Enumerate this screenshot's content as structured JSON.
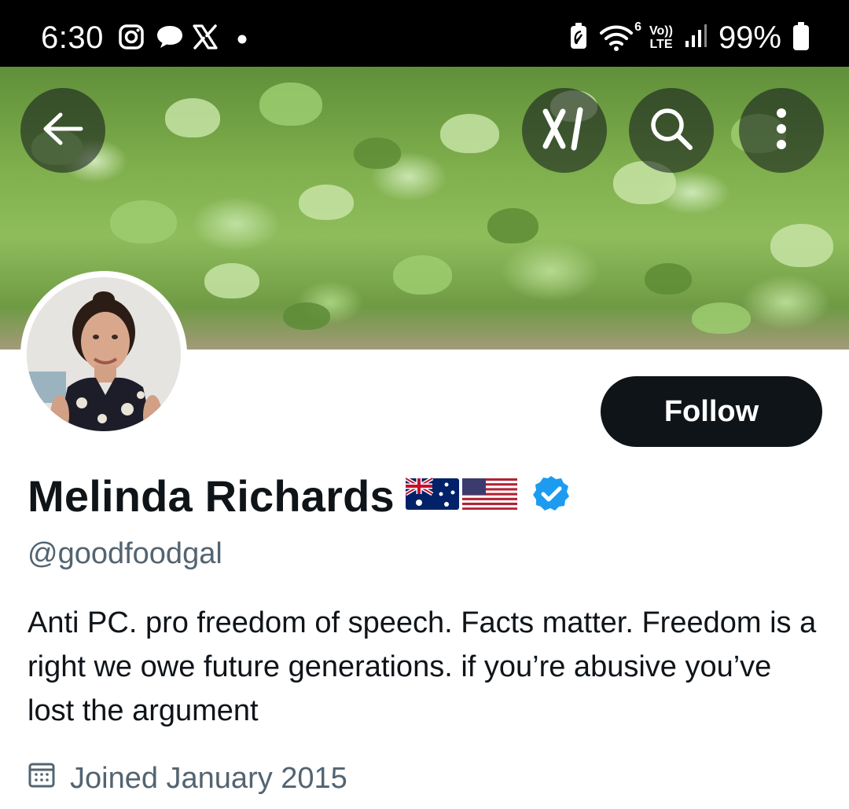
{
  "status_bar": {
    "time": "6:30",
    "battery": "99%",
    "left_icons": [
      "instagram-icon",
      "chat-bubble-icon",
      "x-logo-icon",
      "dot-icon"
    ],
    "right_icons": [
      "battery-saver-icon",
      "wifi-6-icon",
      "volte-lte-icon",
      "signal-icon",
      "battery-icon"
    ],
    "net_top": "Vo))",
    "net_bottom": "LTE",
    "wifi_badge": "6"
  },
  "header": {
    "back_icon": "arrow-left-icon",
    "grok_icon": "grok-icon",
    "search_icon": "search-icon",
    "more_icon": "more-vertical-icon"
  },
  "profile": {
    "display_name": "Melinda Richards",
    "flags": [
      "australia-flag-icon",
      "usa-flag-icon"
    ],
    "verified_icon": "verified-badge-icon",
    "handle": "@goodfoodgal",
    "bio": "Anti PC. pro freedom of speech. Facts matter. Freedom is a right we owe future generations. if you’re abusive you’ve lost the argument",
    "joined": "Joined January 2015",
    "joined_icon": "calendar-icon",
    "follow_label": "Follow"
  },
  "colors": {
    "text": "#0f1419",
    "secondary_text": "#536471",
    "verified_blue": "#1d9bf0",
    "button_bg": "#0f1419"
  }
}
